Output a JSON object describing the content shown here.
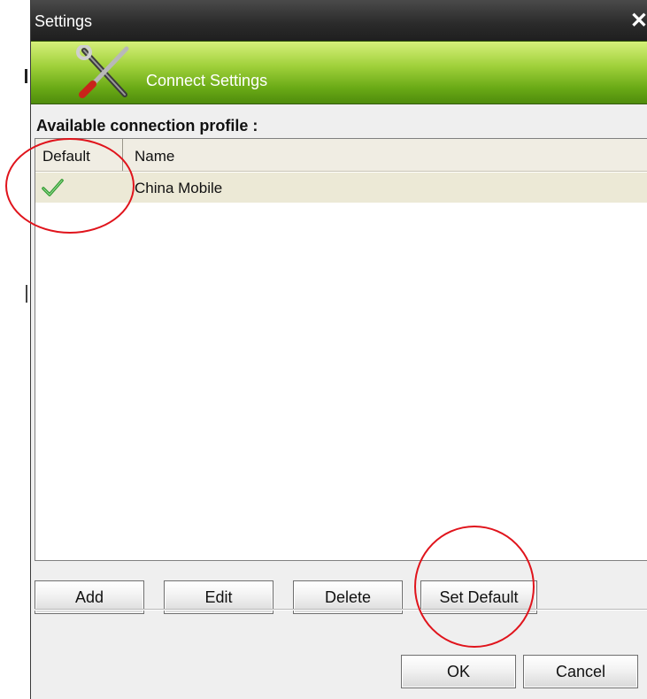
{
  "window": {
    "title": "Settings",
    "close_icon": "close-icon"
  },
  "banner": {
    "title": "Connect Settings",
    "icon": "tools-icon",
    "colors": {
      "gradient_top": "#d6f07a",
      "gradient_bottom": "#4f8c0c"
    }
  },
  "profiles": {
    "section_label": "Available connection profile :",
    "columns": {
      "default": "Default",
      "name": "Name"
    },
    "rows": [
      {
        "default": true,
        "default_icon": "checkmark-icon",
        "name": "China Mobile"
      }
    ]
  },
  "actions": {
    "add": "Add",
    "edit": "Edit",
    "delete": "Delete",
    "set_default": "Set Default"
  },
  "footer": {
    "ok": "OK",
    "cancel": "Cancel"
  },
  "annotations": {
    "color": "#e0141c"
  }
}
